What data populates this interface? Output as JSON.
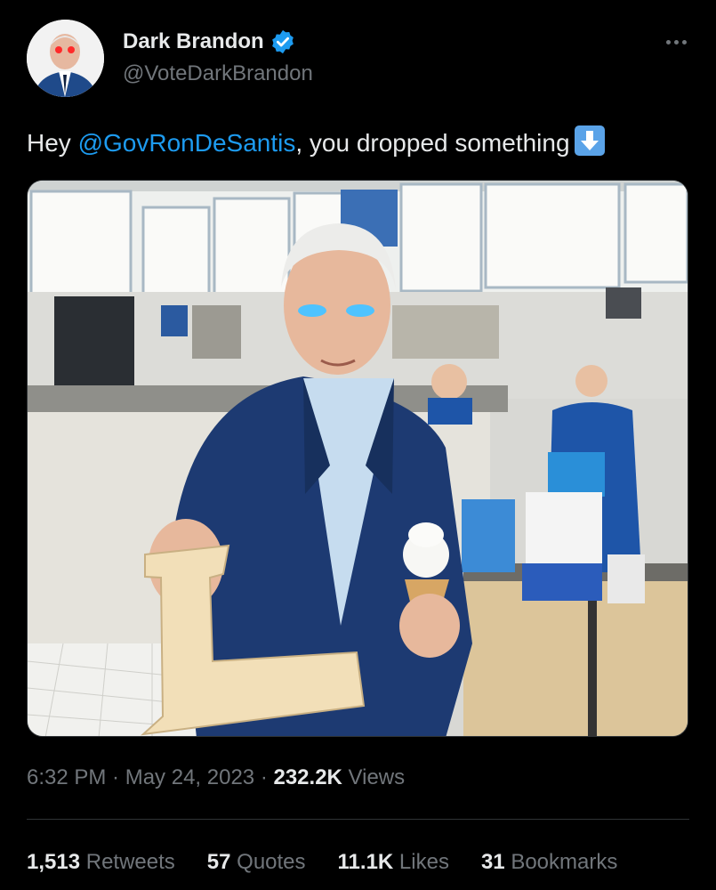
{
  "author": {
    "display_name": "Dark Brandon",
    "handle": "@VoteDarkBrandon",
    "verified": true
  },
  "tweet": {
    "text_before": "Hey ",
    "mention": "@GovRonDeSantis",
    "text_after": ", you dropped something",
    "emoji_icon": "down-arrow-emoji"
  },
  "meta": {
    "time": "6:32 PM",
    "sep1": " · ",
    "date": "May 24, 2023",
    "sep2": " · ",
    "views_count": "232.2K",
    "views_label": " Views"
  },
  "stats": {
    "retweets": {
      "count": "1,513",
      "label": " Retweets"
    },
    "quotes": {
      "count": "57",
      "label": " Quotes"
    },
    "likes": {
      "count": "11.1K",
      "label": " Likes"
    },
    "bookmarks": {
      "count": "31",
      "label": " Bookmarks"
    }
  },
  "colors": {
    "background": "#000000",
    "link": "#1d9bf0",
    "secondary_text": "#71767b",
    "primary_text": "#e7e9ea"
  }
}
